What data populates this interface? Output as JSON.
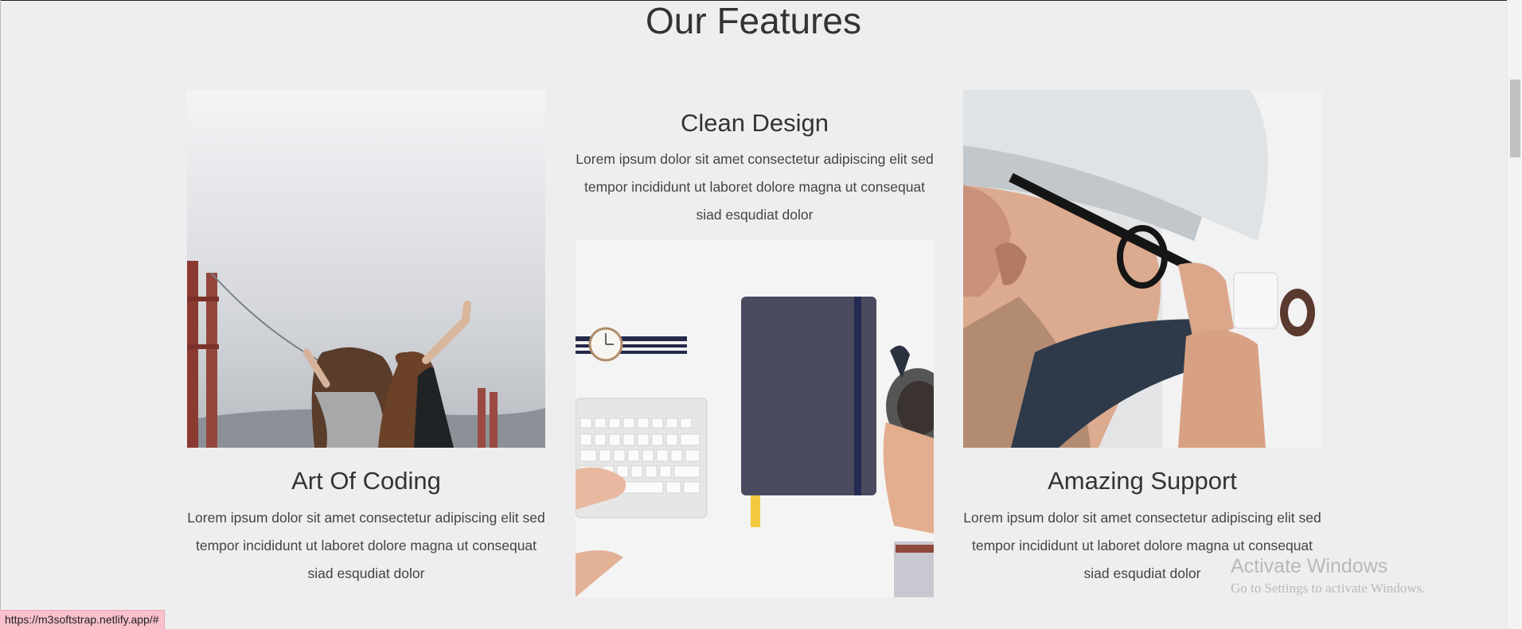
{
  "section": {
    "title": "Our Features"
  },
  "features": [
    {
      "title": "Art Of Coding",
      "text": "Lorem ipsum dolor sit amet consectetur adipiscing elit sed tempor incididunt ut laboret dolore magna ut consequat siad esqudiat dolor",
      "image_icon": "photo-bridge-friends"
    },
    {
      "title": "Clean Design",
      "text": "Lorem ipsum dolor sit amet consectetur adipiscing elit sed tempor incididunt ut laboret dolore magna ut consequat siad esqudiat dolor",
      "image_icon": "photo-desk-notebook"
    },
    {
      "title": "Amazing Support",
      "text": "Lorem ipsum dolor sit amet consectetur adipiscing elit sed tempor incididunt ut laboret dolore magna ut consequat siad esqudiat dolor",
      "image_icon": "photo-technician"
    }
  ],
  "status_bar": {
    "url": "https://m3softstrap.netlify.app/#"
  },
  "watermark": {
    "title": "Activate Windows",
    "subtitle": "Go to Settings to activate Windows."
  },
  "colors": {
    "background": "#eeeeee",
    "text": "#333333"
  }
}
